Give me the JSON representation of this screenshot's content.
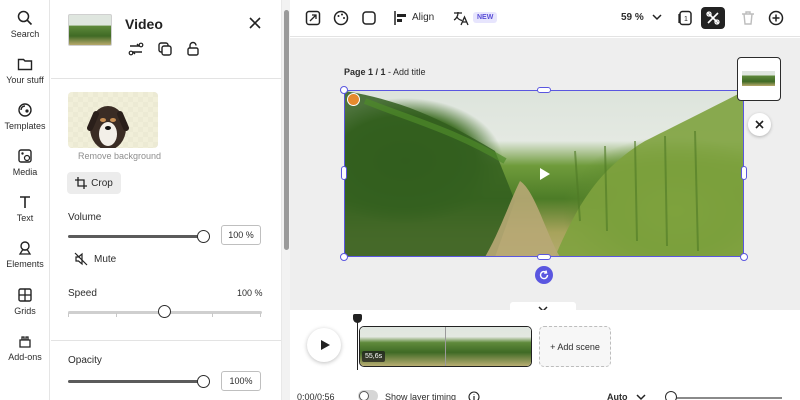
{
  "rail": {
    "items": [
      {
        "label": "Search",
        "icon": "search-icon"
      },
      {
        "label": "Your stuff",
        "icon": "folder-icon"
      },
      {
        "label": "Templates",
        "icon": "templates-icon"
      },
      {
        "label": "Media",
        "icon": "media-icon"
      },
      {
        "label": "Text",
        "icon": "text-icon"
      },
      {
        "label": "Elements",
        "icon": "elements-icon"
      },
      {
        "label": "Grids",
        "icon": "grid-icon"
      },
      {
        "label": "Add-ons",
        "icon": "addons-icon"
      }
    ]
  },
  "panel": {
    "title": "Video",
    "remove_background_label": "Remove background",
    "crop_label": "Crop",
    "volume_label": "Volume",
    "volume_value": "100 %",
    "mute_label": "Mute",
    "speed_label": "Speed",
    "speed_value": "100 %",
    "opacity_label": "Opacity",
    "opacity_value": "100%"
  },
  "toolbar": {
    "align_label": "Align",
    "new_badge": "NEW",
    "zoom_value": "59 %"
  },
  "canvas": {
    "page_label_bold": "Page 1 / 1",
    "page_label_rest": " - Add title"
  },
  "timeline": {
    "clip_duration": "55,6s",
    "add_scene_label": "+ Add scene",
    "time": "0:00/0:56",
    "show_layer_timing": "Show layer timing",
    "auto_label": "Auto"
  },
  "colors": {
    "accent": "#5a56e0",
    "badge_bg": "#e7e5fd"
  }
}
